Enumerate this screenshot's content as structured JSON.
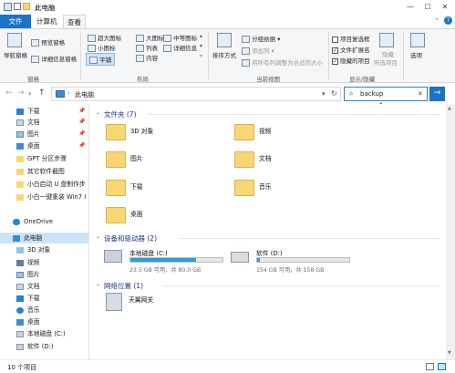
{
  "titlebar": {
    "title": "此电脑",
    "minimize": "—",
    "maximize": "☐",
    "close": "✕"
  },
  "ribbon_tabs": {
    "file": "文件",
    "computer": "计算机",
    "view": "查看"
  },
  "ribbon": {
    "pane": {
      "nav_pane": "导航窗格",
      "preview_pane": "预览窗格",
      "details_pane": "详细信息窗格",
      "group": "窗格"
    },
    "layout": {
      "xl_icons": "超大图标",
      "l_icons": "大图标",
      "m_icons": "中等图标",
      "s_icons": "小图标",
      "list": "列表",
      "details": "详细信息",
      "tiles": "平铺",
      "content": "内容",
      "group": "布局"
    },
    "current_view": {
      "sort": "排序方式",
      "group_by": "分组依据",
      "add_columns": "添加列",
      "fit_columns": "将所有列调整为合适的大小",
      "group": "当前视图"
    },
    "show_hide": {
      "item_checkboxes": "项目复选框",
      "file_ext": "文件扩展名",
      "hidden_items": "隐藏的项目",
      "hide_selected": "隐藏",
      "selected_items": "所选项目",
      "group": "显示/隐藏"
    },
    "options": "选项"
  },
  "nav": {
    "address": "此电脑",
    "search_value": "backup",
    "search_clear": "✕",
    "go": "→"
  },
  "sidebar": {
    "items": [
      "下载",
      "文档",
      "图片",
      "桌面",
      "GPT 分区步骤",
      "其它软件截图",
      "小白启动 U 盘制作步",
      "小白一键重装 Win7 I",
      "OneDrive",
      "此电脑",
      "3D 对象",
      "视频",
      "图片",
      "文档",
      "下载",
      "音乐",
      "桌面",
      "本地磁盘 (C:)",
      "软件 (D:)"
    ]
  },
  "main": {
    "folders_header": "文件夹 (7)",
    "folders": [
      "3D 对象",
      "视频",
      "图片",
      "文档",
      "下载",
      "音乐",
      "桌面"
    ],
    "devices_header": "设备和驱动器 (2)",
    "drives": [
      {
        "name": "本地磁盘 (C:)",
        "free": "23.5 GB 可用，共 80.0 GB",
        "used_fraction": 0.71
      },
      {
        "name": "软件 (D:)",
        "free": "154 GB 可用，共 158 GB",
        "used_fraction": 0.03
      }
    ],
    "network_header": "网络位置 (1)",
    "network": [
      "天翼网关"
    ]
  },
  "status": {
    "count": "10 个项目"
  },
  "colors": {
    "accent": "#1a73c9",
    "folder": "#f7d774",
    "drive_fill": "#26a0da",
    "section": "#1e3287",
    "annotation": "#d83a30"
  }
}
